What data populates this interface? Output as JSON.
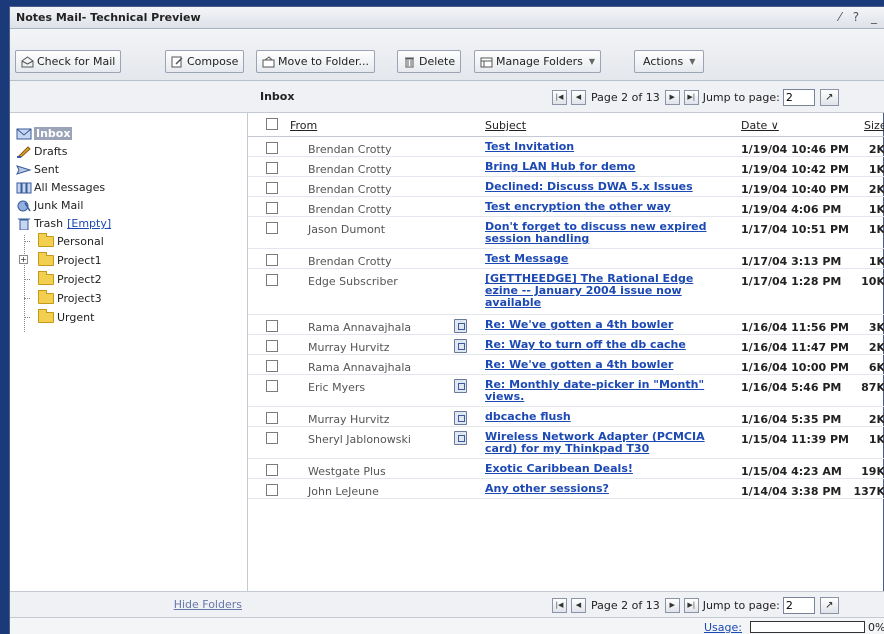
{
  "window": {
    "title": "Notes Mail- Technical Preview",
    "controls": "⁄ ? _"
  },
  "toolbar": {
    "check_mail": "Check for Mail",
    "compose": "Compose",
    "move_to_folder": "Move to Folder...",
    "delete": "Delete",
    "manage_folders": "Manage Folders",
    "actions": "Actions"
  },
  "folders": {
    "inbox": "Inbox",
    "drafts": "Drafts",
    "sent": "Sent",
    "all_messages": "All Messages",
    "junk_mail": "Junk Mail",
    "trash": "Trash",
    "empty_link": "[Empty]",
    "personal": "Personal",
    "project1": "Project1",
    "project2": "Project2",
    "project3": "Project3",
    "urgent": "Urgent",
    "hide_folders": "Hide Folders"
  },
  "view": {
    "label": "Inbox"
  },
  "pager": {
    "page_text": "Page 2 of 13",
    "jump_label": "Jump to page:",
    "jump_value": "2"
  },
  "columns": {
    "from": "From",
    "subject": "Subject",
    "date": "Date ∨",
    "size": "Size"
  },
  "messages": [
    {
      "from": "Brendan Crotty",
      "subject": "Test Invitation",
      "date": "1/19/04 10:46 PM",
      "size": "2K",
      "attachment": false
    },
    {
      "from": "Brendan Crotty",
      "subject": "Bring LAN Hub for demo",
      "date": "1/19/04 10:42 PM",
      "size": "1K",
      "attachment": false
    },
    {
      "from": "Brendan Crotty",
      "subject": "Declined: Discuss DWA 5.x Issues",
      "date": "1/19/04 10:40 PM",
      "size": "2K",
      "attachment": false
    },
    {
      "from": "Brendan Crotty",
      "subject": "Test encryption the other way",
      "date": "1/19/04 4:06 PM",
      "size": "1K",
      "attachment": false
    },
    {
      "from": "Jason Dumont",
      "subject": "Don't forget to discuss new expired session handling",
      "date": "1/17/04 10:51 PM",
      "size": "1K",
      "attachment": false
    },
    {
      "from": "Brendan Crotty",
      "subject": "Test Message",
      "date": "1/17/04 3:13 PM",
      "size": "1K",
      "attachment": false
    },
    {
      "from": "Edge Subscriber",
      "subject": "[GETTHEEDGE] The Rational Edge ezine -- January 2004 issue now available",
      "date": "1/17/04 1:28 PM",
      "size": "10K",
      "attachment": false
    },
    {
      "from": "Rama Annavajhala",
      "subject": "Re: We've gotten a 4th bowler",
      "date": "1/16/04 11:56 PM",
      "size": "3K",
      "attachment": true
    },
    {
      "from": "Murray Hurvitz",
      "subject": "Re: Way to turn off the db cache",
      "date": "1/16/04 11:47 PM",
      "size": "2K",
      "attachment": true
    },
    {
      "from": "Rama Annavajhala",
      "subject": "Re: We've gotten a 4th bowler",
      "date": "1/16/04 10:00 PM",
      "size": "6K",
      "attachment": false
    },
    {
      "from": "Eric Myers",
      "subject": "Re: Monthly date-picker in \"Month\" views.",
      "date": "1/16/04 5:46 PM",
      "size": "87K",
      "attachment": true
    },
    {
      "from": "Murray Hurvitz",
      "subject": "dbcache flush",
      "date": "1/16/04 5:35 PM",
      "size": "2K",
      "attachment": true
    },
    {
      "from": "Sheryl Jablonowski",
      "subject": "Wireless Network Adapter (PCMCIA card) for my Thinkpad T30",
      "date": "1/15/04 11:39 PM",
      "size": "1K",
      "attachment": true
    },
    {
      "from": "Westgate Plus",
      "subject": "Exotic Caribbean Deals!",
      "date": "1/15/04 4:23 AM",
      "size": "19K",
      "attachment": false
    },
    {
      "from": "John LeJeune",
      "subject": "Any other sessions?",
      "date": "1/14/04 3:38 PM",
      "size": "137K",
      "attachment": false
    }
  ],
  "status": {
    "usage_label": "Usage:",
    "usage_percent": "0%",
    "usage_fraction": 0
  }
}
